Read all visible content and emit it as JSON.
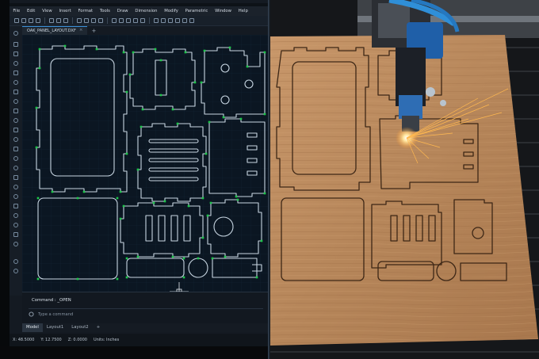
{
  "menubar": {
    "items": [
      "File",
      "Edit",
      "View",
      "Insert",
      "Format",
      "Tools",
      "Draw",
      "Dimension",
      "Modify",
      "Parametric",
      "Window",
      "Help"
    ]
  },
  "document_tab": {
    "label": "OAK_PANEL_LAYOUT.DXF",
    "close": "×",
    "add": "+"
  },
  "command_line": {
    "history": "Command : _OPEN",
    "placeholder": "Type a command"
  },
  "layout_tabs": [
    "Model",
    "Layout1",
    "Layout2",
    "+"
  ],
  "status": {
    "x": "X: 48.5000",
    "y": "Y: 12.7500",
    "z": "Z: 0.0000",
    "units": "Units: Inches"
  },
  "icons": {
    "toolbar": [
      "new-file-icon",
      "open-folder-icon",
      "save-icon",
      "save-as-icon",
      "print-icon",
      "undo-icon",
      "redo-icon",
      "cut-icon",
      "copy-icon",
      "paste-icon",
      "match-properties-icon",
      "zoom-icon",
      "pan-icon",
      "layer-icon",
      "properties-icon",
      "block-icon",
      "measure-icon",
      "snap-icon",
      "grid-icon",
      "ortho-icon",
      "osnap-icon",
      "settings-icon"
    ],
    "command": "command-history-icon",
    "crosshair": "crosshair-cursor-icon"
  },
  "colors": {
    "cad_background": "#0b1622",
    "entity": "#c8d6e2",
    "grip": "#1ec84b",
    "accent": "#3a8fd8",
    "wood": "#b8875a",
    "engrave": "#3d2716"
  }
}
